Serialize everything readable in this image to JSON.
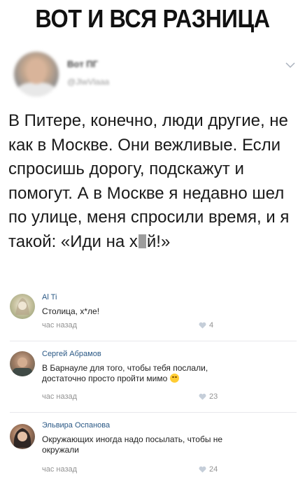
{
  "headline": "ВОТ И ВСЯ РАЗНИЦА",
  "tweet": {
    "author_name": "Boт ПГ",
    "author_handle": "@JlwVlaaa",
    "text_before": "В Питере, конечно, люди другие, не как в Москве. Они вежливые. Если спросишь дорогу, подскажут и помогут. А в Москве я недавно шел по улице, меня спросили время, и я такой: «Иди на х",
    "text_after": "й!»"
  },
  "comments": [
    {
      "name": "Al Ti",
      "text": "Столица, х*ле!",
      "time": "час назад",
      "likes": "4"
    },
    {
      "name": "Сергей Абрамов",
      "text": "В Барнауле для того, чтобы тебя послали, достаточно просто пройти мимо",
      "time": "час назад",
      "likes": "23",
      "emoji": "smiling-face-emoji"
    },
    {
      "name": "Эльвира Оспанова",
      "text": "Окружающих иногда надо посылать, чтобы не окружали",
      "time": "час назад",
      "likes": "24"
    }
  ],
  "colors": {
    "link": "#2a5885",
    "muted": "#939393",
    "divider": "#e7e8ec"
  }
}
